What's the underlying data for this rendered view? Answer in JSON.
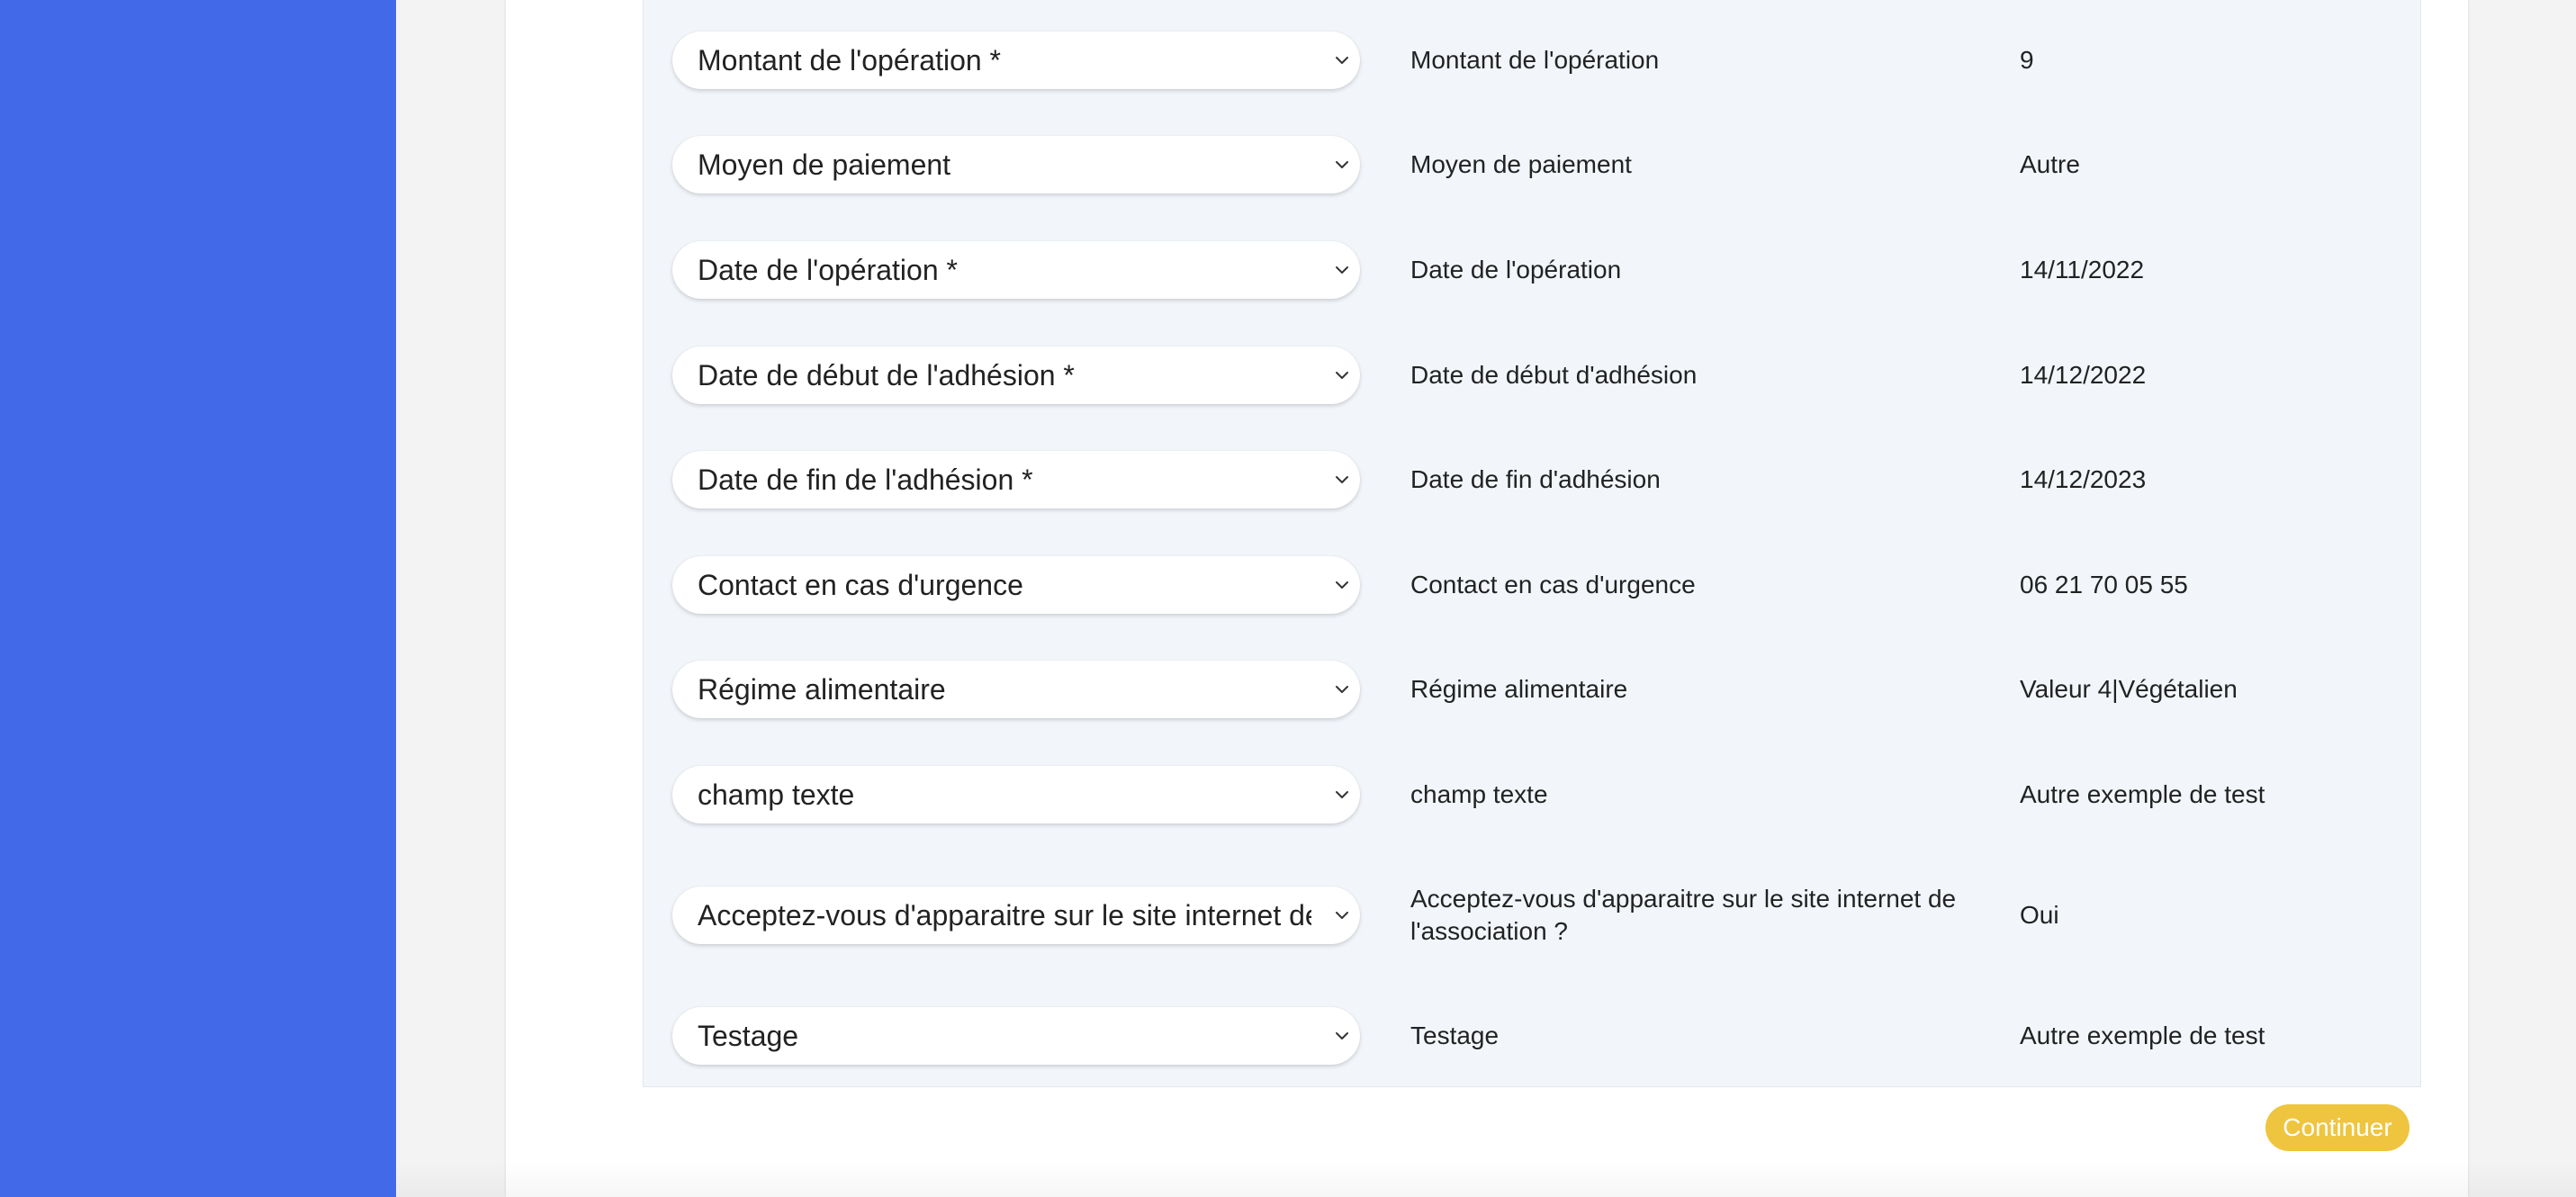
{
  "colors": {
    "sidebar": "#4169e8",
    "panel_background": "#f2f6fb",
    "continue_button": "#efc53f"
  },
  "rows": [
    {
      "select": "Montant de l'opération *",
      "label": "Montant de l'opération",
      "value": "9"
    },
    {
      "select": "Moyen de paiement",
      "label": "Moyen de paiement",
      "value": "Autre"
    },
    {
      "select": "Date de l'opération *",
      "label": "Date de l'opération",
      "value": "14/11/2022"
    },
    {
      "select": "Date de début de l'adhésion *",
      "label": "Date de début d'adhésion",
      "value": "14/12/2022"
    },
    {
      "select": "Date de fin de l'adhésion *",
      "label": "Date de fin d'adhésion",
      "value": "14/12/2023"
    },
    {
      "select": "Contact en cas d'urgence",
      "label": "Contact en cas d'urgence",
      "value": "06 21 70 05 55"
    },
    {
      "select": "Régime alimentaire",
      "label": "Régime alimentaire",
      "value": "Valeur 4|Végétalien"
    },
    {
      "select": "champ texte",
      "label": "champ texte",
      "value": "Autre exemple de test"
    },
    {
      "select": "Acceptez-vous d'apparaitre sur le site internet de l'association ?",
      "label": "Acceptez-vous d'apparaitre sur le site internet de l'association ?",
      "value": "Oui"
    },
    {
      "select": "Testage",
      "label": "Testage",
      "value": "Autre exemple de test"
    }
  ],
  "continue_label": "Continuer",
  "icons": {
    "dropdown": "chevron-down-icon"
  }
}
